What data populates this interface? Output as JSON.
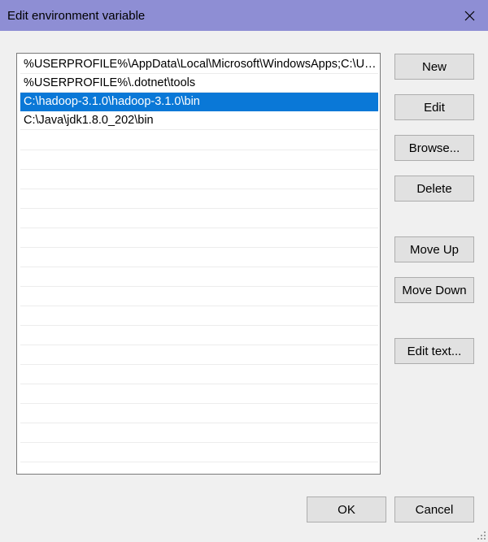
{
  "window": {
    "title": "Edit environment variable",
    "close_icon": "close-icon"
  },
  "variables": [
    {
      "value": "%USERPROFILE%\\AppData\\Local\\Microsoft\\WindowsApps;C:\\Us...",
      "selected": false
    },
    {
      "value": "%USERPROFILE%\\.dotnet\\tools",
      "selected": false
    },
    {
      "value": "C:\\hadoop-3.1.0\\hadoop-3.1.0\\bin",
      "selected": true
    },
    {
      "value": "C:\\Java\\jdk1.8.0_202\\bin",
      "selected": false
    }
  ],
  "buttons": {
    "new": "New",
    "edit": "Edit",
    "browse": "Browse...",
    "delete": "Delete",
    "move_up": "Move Up",
    "move_down": "Move Down",
    "edit_text": "Edit text...",
    "ok": "OK",
    "cancel": "Cancel"
  },
  "colors": {
    "titlebar": "#8e8ed4",
    "selection": "#0a78d7",
    "background": "#f0f0f0"
  }
}
